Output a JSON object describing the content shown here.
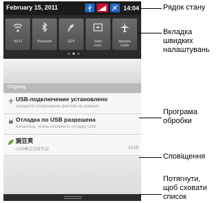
{
  "status_bar": {
    "date": "February 15, 2011",
    "time": "14:04",
    "icons": [
      "usb-icon",
      "signal-icon",
      "debug-icon"
    ]
  },
  "quick_settings": {
    "tiles": [
      {
        "label": "Wi-Fi",
        "icon": "wifi-icon"
      },
      {
        "label": "Bluetooth",
        "icon": "bluetooth-icon"
      },
      {
        "label": "GPS",
        "icon": "gps-icon"
      },
      {
        "label": "Data\nconn.",
        "icon": "data-icon"
      },
      {
        "label": "Airplane\nmode",
        "icon": "airplane-icon"
      }
    ]
  },
  "ongoing": {
    "header": "Ongoing",
    "items": [
      {
        "title": "USB-подключение установлено",
        "sub": "Выберите копирование файлов на компьют"
      },
      {
        "title": "Отладка по USB разрешена",
        "sub": "Коснитесь, чтобы отключить отладку USB."
      },
      {
        "title": "豌豆荚",
        "sub": "USB模式已经开启",
        "time": "13:55"
      }
    ]
  },
  "callouts": [
    "Рядок стану",
    "Вкладка\nшвидких\nналаштувань",
    "Програма\nобробки",
    "Сповіщення",
    "Потягнути,\nщоб сховати\nсписок"
  ],
  "colors": {
    "status_bar": "#1b1b1b",
    "usb_blue": "#1f66c9",
    "signal_red": "#c8102e"
  }
}
